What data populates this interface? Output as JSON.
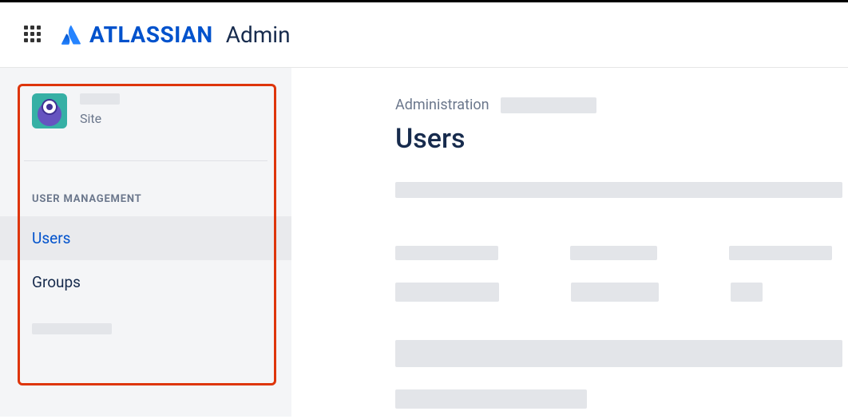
{
  "header": {
    "brand": "ATLASSIAN",
    "product": "Admin"
  },
  "sidebar": {
    "site_type": "Site",
    "section_label": "USER MANAGEMENT",
    "items": [
      {
        "label": "Users",
        "selected": true
      },
      {
        "label": "Groups",
        "selected": false
      }
    ]
  },
  "main": {
    "breadcrumb": "Administration",
    "title": "Users"
  }
}
